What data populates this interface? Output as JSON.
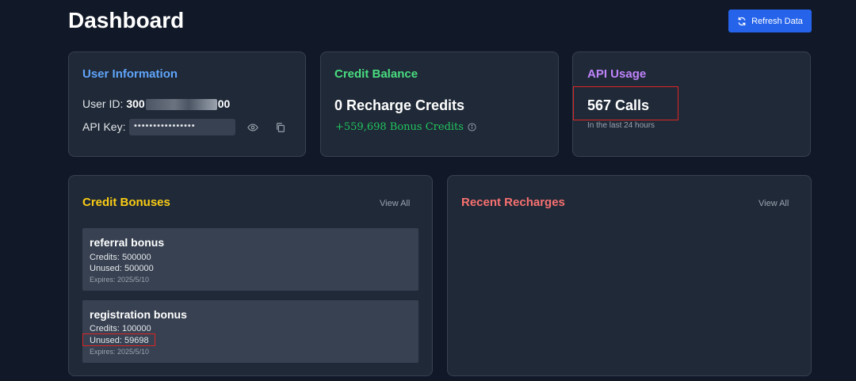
{
  "header": {
    "title": "Dashboard",
    "refresh_label": "Refresh Data"
  },
  "colors": {
    "accent": "#2563eb",
    "user_title": "#60a5fa",
    "credit_title": "#4ade80",
    "api_title": "#c084fc",
    "bonus_title": "#facc15",
    "recharge_title": "#f87171",
    "highlight": "#dc2626"
  },
  "user_info": {
    "title": "User Information",
    "user_id_label": "User ID:",
    "user_id_start": "300",
    "user_id_end": "00",
    "api_key_label": "API Key:",
    "api_key_masked": "••••••••••••••••",
    "show_icon": "eye-icon",
    "copy_icon": "copy-icon"
  },
  "credit_balance": {
    "title": "Credit Balance",
    "recharge_credits": "0 Recharge Credits",
    "bonus_credits": "+559,698 Bonus Credits",
    "info_icon": "info-icon"
  },
  "api_usage": {
    "title": "API Usage",
    "calls": "567 Calls",
    "period": "In the last 24 hours"
  },
  "credit_bonuses": {
    "title": "Credit Bonuses",
    "view_all": "View All",
    "items": [
      {
        "name": "referral bonus",
        "credits": "Credits: 500000",
        "unused": "Unused: 500000",
        "expires": "Expires: 2025/5/10"
      },
      {
        "name": "registration bonus",
        "credits": "Credits: 100000",
        "unused": "Unused: 59698",
        "expires": "Expires: 2025/5/10"
      }
    ]
  },
  "recent_recharges": {
    "title": "Recent Recharges",
    "view_all": "View All"
  }
}
